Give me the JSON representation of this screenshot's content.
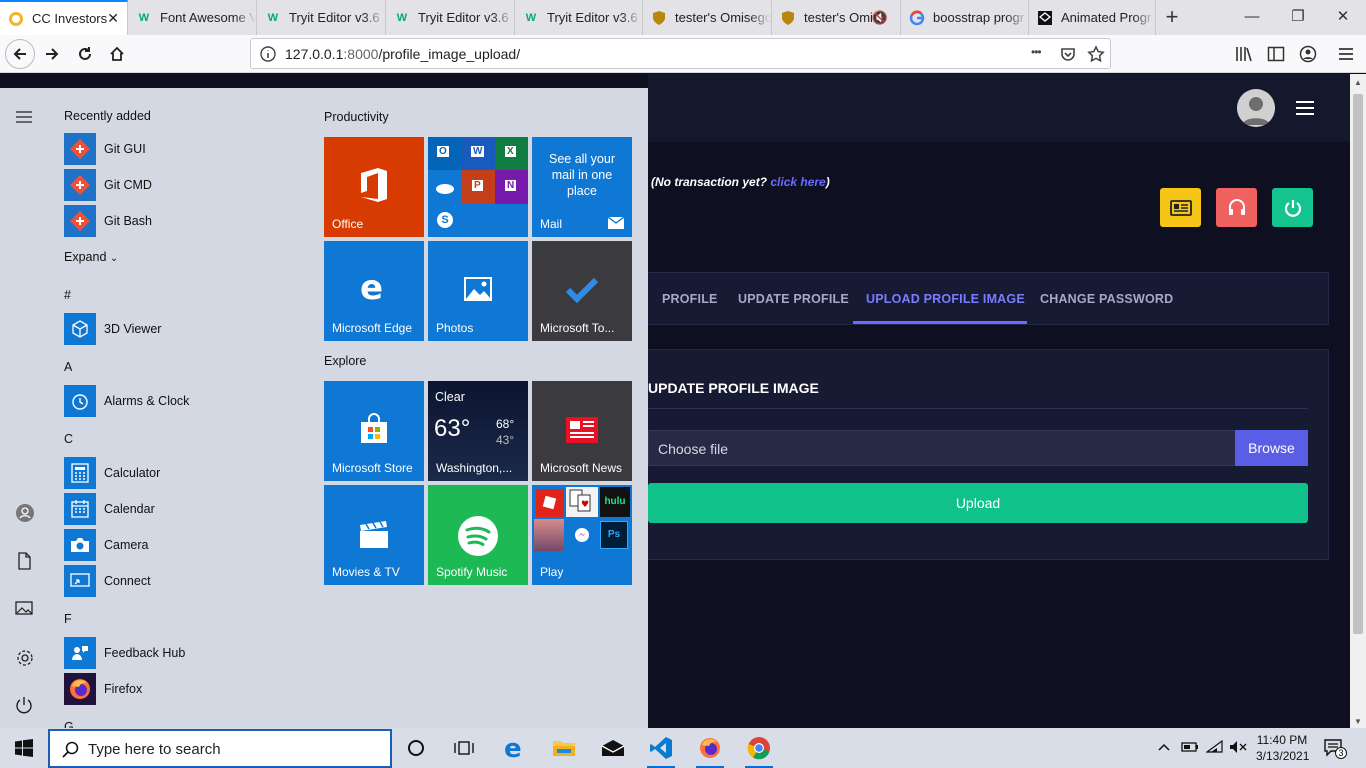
{
  "browser": {
    "tabs": [
      {
        "title": "CC Investors",
        "active": true
      },
      {
        "title": "Font Awesome V"
      },
      {
        "title": "Tryit Editor v3.6"
      },
      {
        "title": "Tryit Editor v3.6"
      },
      {
        "title": "Tryit Editor v3.6"
      },
      {
        "title": "tester's Omisego"
      },
      {
        "title": "tester's Omis"
      },
      {
        "title": "boosstrap progr"
      },
      {
        "title": "Animated Progr"
      }
    ],
    "url_host": "127.0.0.1",
    "url_port": ":8000",
    "url_path": "/profile_image_upload/",
    "page_actions": "•••"
  },
  "page": {
    "no_transaction_text": "(No transaction yet? ",
    "no_transaction_link": "click here",
    "no_transaction_close": ")",
    "tabs": [
      "PROFILE",
      "UPDATE PROFILE",
      "UPLOAD PROFILE IMAGE",
      "CHANGE PASSWORD"
    ],
    "card_title": "UPDATE PROFILE IMAGE",
    "file_placeholder": "Choose file",
    "browse_label": "Browse",
    "upload_label": "Upload",
    "colors": {
      "accent": "#6a6cff",
      "upload": "#10c18a",
      "btn_yellow": "#f5c518",
      "btn_red": "#f0625f",
      "btn_green": "#14c38e"
    }
  },
  "start_menu": {
    "recently_added_title": "Recently added",
    "recent": [
      "Git GUI",
      "Git CMD",
      "Git Bash"
    ],
    "expand_label": "Expand",
    "sections": [
      {
        "letter": "#",
        "apps": [
          "3D Viewer"
        ]
      },
      {
        "letter": "A",
        "apps": [
          "Alarms & Clock"
        ]
      },
      {
        "letter": "C",
        "apps": [
          "Calculator",
          "Calendar",
          "Camera",
          "Connect"
        ]
      },
      {
        "letter": "F",
        "apps": [
          "Feedback Hub",
          "Firefox"
        ]
      },
      {
        "letter": "G",
        "apps": []
      }
    ],
    "productivity_title": "Productivity",
    "explore_title": "Explore",
    "tiles": {
      "office": "Office",
      "mail_promo": "See all your mail in one place",
      "mail": "Mail",
      "edge": "Microsoft Edge",
      "photos": "Photos",
      "todo": "Microsoft To...",
      "store": "Microsoft Store",
      "weather_cond": "Clear",
      "weather_temp": "63°",
      "weather_hi": "68°",
      "weather_lo": "43°",
      "weather_city": "Washington,...",
      "news": "Microsoft News",
      "movies": "Movies & TV",
      "spotify": "Spotify Music",
      "play": "Play"
    }
  },
  "taskbar": {
    "search_placeholder": "Type here to search",
    "time": "11:40 PM",
    "date": "3/13/2021",
    "notifications": "3"
  }
}
